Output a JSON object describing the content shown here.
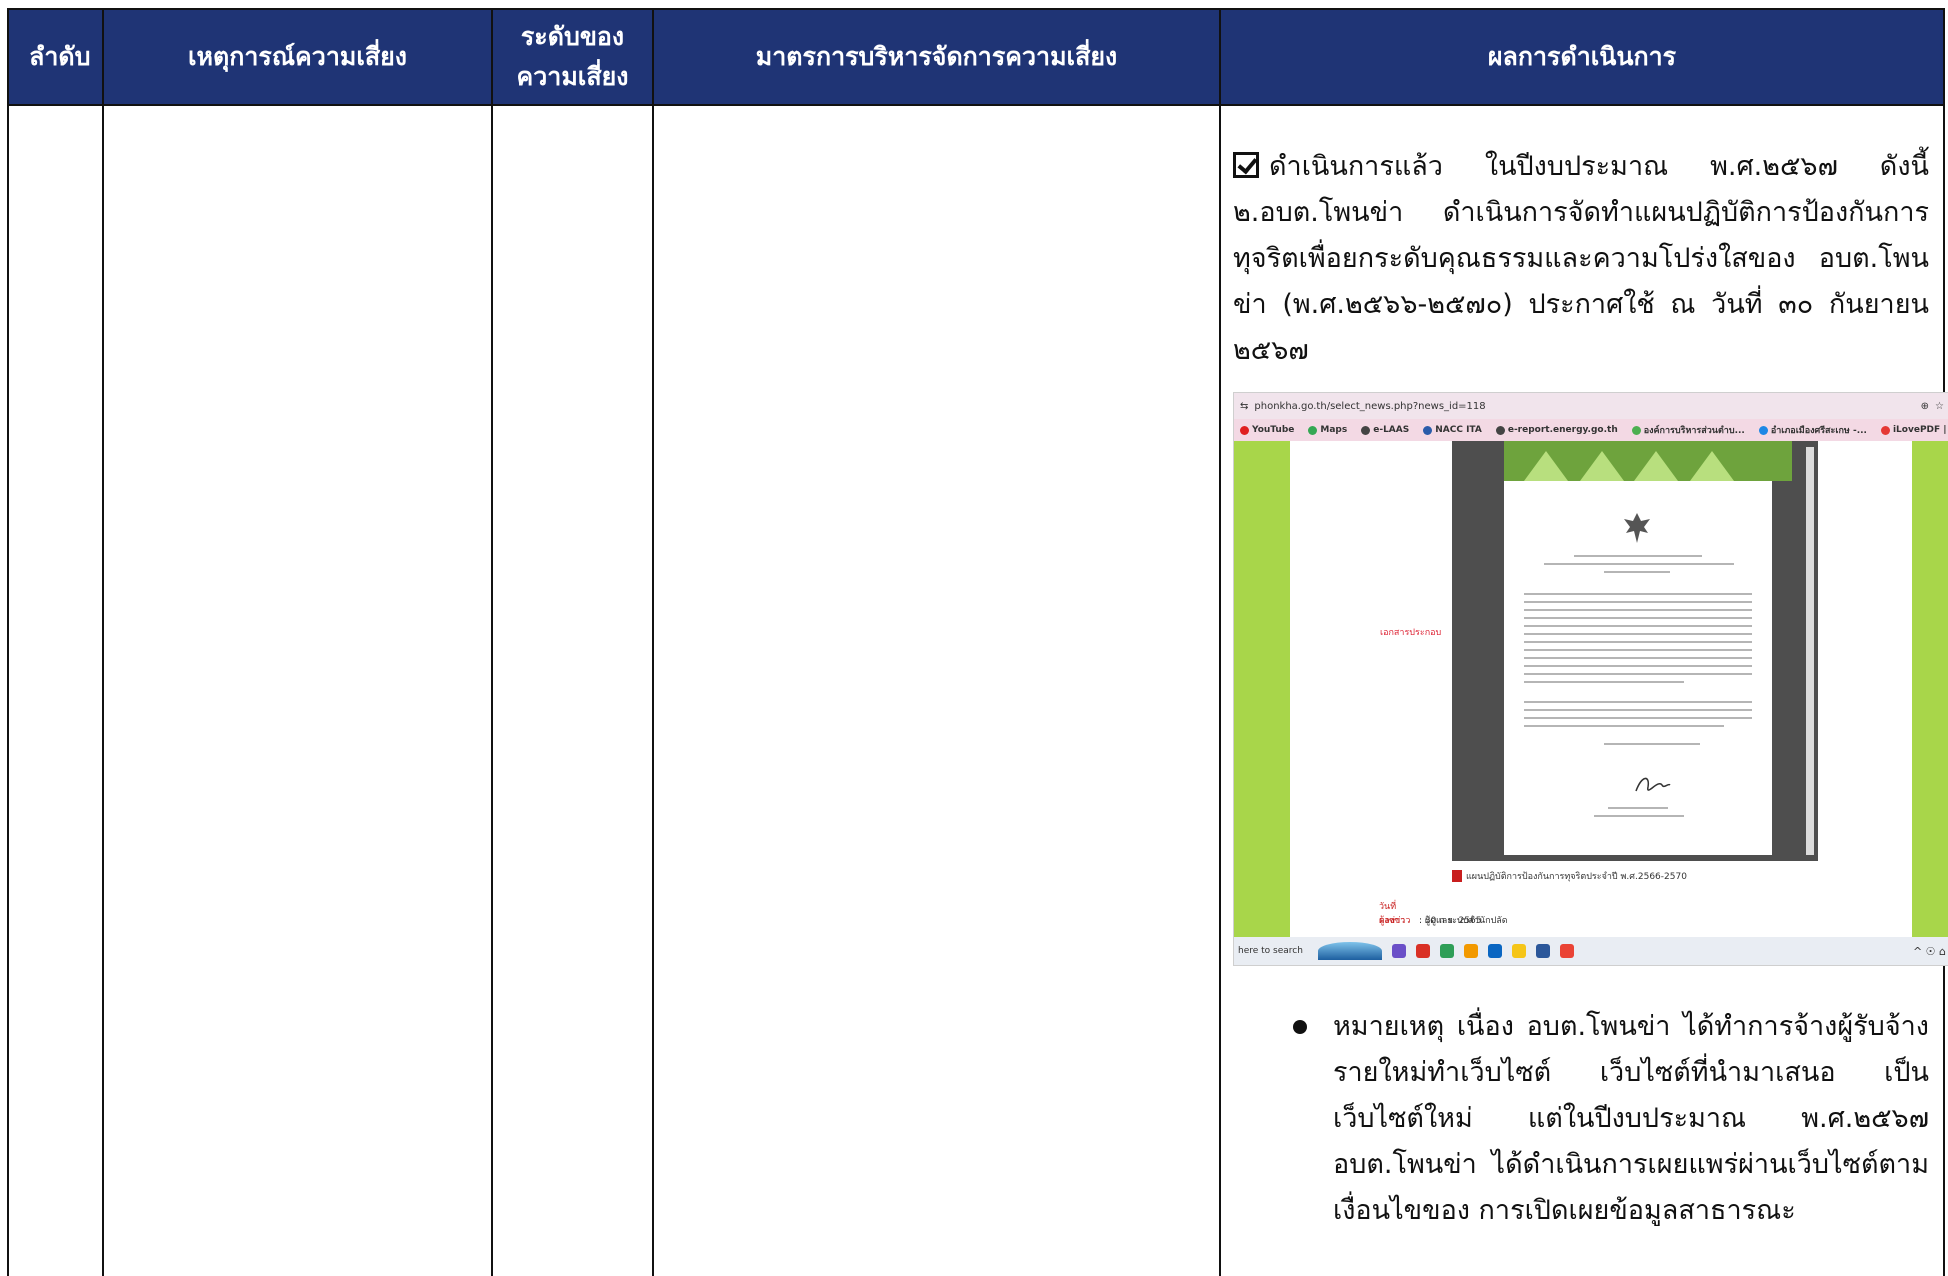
{
  "table": {
    "headers": [
      "ลำดับ",
      "เหตุการณ์ความเสี่ยง",
      "ระดับของความเสี่ยง",
      "มาตรการบริหารจัดการความเสี่ยง",
      "ผลการดำเนินการ"
    ],
    "header_bg": "#1f3475",
    "result": {
      "checkbox_icon": "checked-box-icon",
      "paragraph": "ดำเนินการแล้ว ในปีงบประมาณ พ.ศ.๒๕๖๗ ดังนี้ ๒.อบต.โพนข่า ดำเนินการจัดทำแผนปฏิบัติการป้องกันการทุจริตเพื่อยกระดับคุณธรรมและความโปร่งใสของ อบต.โพนข่า (พ.ศ.๒๕๖๖-๒๕๗๐) ประกาศใช้ ณ วันที่ ๓๐ กันยายน ๒๕๖๗",
      "note": "หมายเหตุ เนื่อง อบต.โพนข่า ได้ทำการจ้างผู้รับจ้างรายใหม่ทำเว็บไซต์ เว็บไซต์ที่นำมาเสนอ เป็นเว็บไซต์ใหม่ แต่ในปีงบประมาณ พ.ศ.๒๕๖๗ อบต.โพนข่า ได้ดำเนินการเผยแพร่ผ่านเว็บไซต์ตาม เงื่อนไขของ การเปิดเผยข้อมูลสาธารณะ"
    }
  },
  "screenshot": {
    "url": "phonkha.go.th/select_news.php?news_id=118",
    "bookmarks": [
      "YouTube",
      "Maps",
      "e-LAAS",
      "NACC ITA",
      "e-report.energy.go.th",
      "องค์การบริหารส่วนตำบ...",
      "อำเภอเมืองศรีสะเกษ -...",
      "iLovePDF | Online P..."
    ],
    "doc_label": "เอกสารประกอบ",
    "pdf_name": "แผนปฏิบัติการป้องกันการทุจริตประจำปี พ.ศ.2566-2570",
    "date_label": "วันที่ลงข่าว",
    "date_value": ": 30 ก.ย. 2565",
    "author_label": "ผู้ลงข่าว",
    "author_value": ": ผู้ดูแลระบบสำนักปลัด",
    "search_text": "here to search"
  }
}
